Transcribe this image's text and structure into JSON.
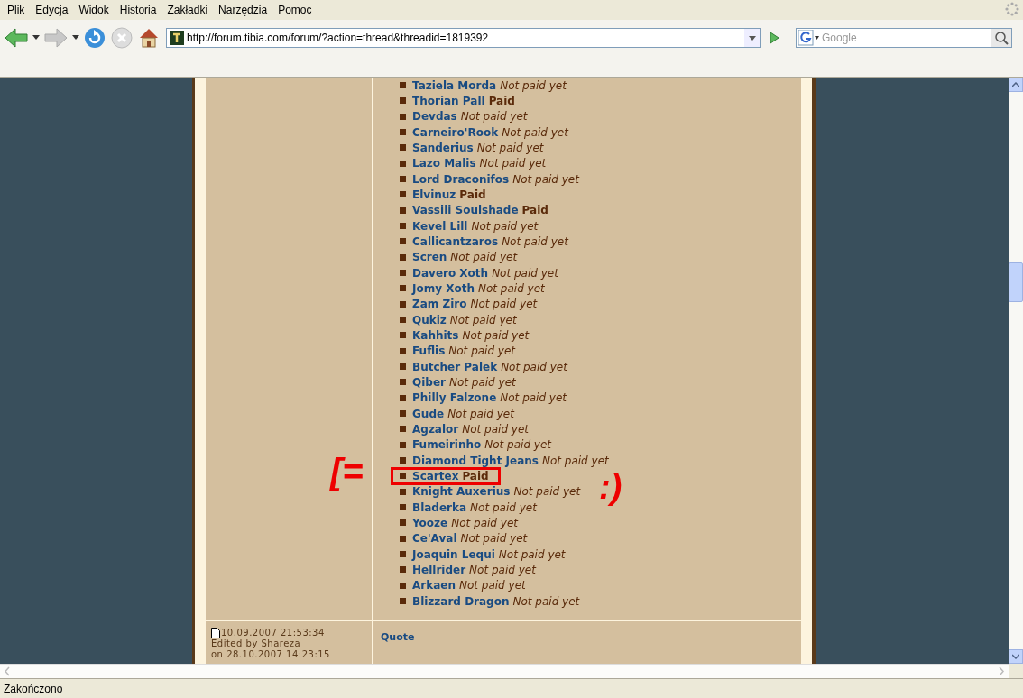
{
  "menu": [
    "Plik",
    "Edycja",
    "Widok",
    "Historia",
    "Zakładki",
    "Narzędzia",
    "Pomoc"
  ],
  "address": {
    "value": "http://forum.tibia.com/forum/?action=thread&threadid=1819392"
  },
  "search": {
    "placeholder": "Google"
  },
  "entries": [
    {
      "name": "Taziela Morda",
      "status": "Not paid yet",
      "paid": false
    },
    {
      "name": "Thorian Pall",
      "status": "Paid",
      "paid": true
    },
    {
      "name": "Devdas",
      "status": "Not paid yet",
      "paid": false
    },
    {
      "name": "Carneiro'Rook",
      "status": "Not paid yet",
      "paid": false
    },
    {
      "name": "Sanderius",
      "status": "Not paid yet",
      "paid": false
    },
    {
      "name": "Lazo Malis",
      "status": "Not paid yet",
      "paid": false
    },
    {
      "name": "Lord Draconifos",
      "status": "Not paid yet",
      "paid": false
    },
    {
      "name": "Elvinuz",
      "status": "Paid",
      "paid": true
    },
    {
      "name": "Vassili Soulshade",
      "status": "Paid",
      "paid": true
    },
    {
      "name": "Kevel Lill",
      "status": "Not paid yet",
      "paid": false
    },
    {
      "name": "Callicantzaros",
      "status": "Not paid yet",
      "paid": false
    },
    {
      "name": "Scren",
      "status": "Not paid yet",
      "paid": false
    },
    {
      "name": "Davero Xoth",
      "status": "Not paid yet",
      "paid": false
    },
    {
      "name": "Jomy Xoth",
      "status": "Not paid yet",
      "paid": false
    },
    {
      "name": "Zam Ziro",
      "status": "Not paid yet",
      "paid": false
    },
    {
      "name": "Qukiz",
      "status": "Not paid yet",
      "paid": false
    },
    {
      "name": "Kahhits",
      "status": "Not paid yet",
      "paid": false
    },
    {
      "name": "Fuflis",
      "status": "Not paid yet",
      "paid": false
    },
    {
      "name": "Butcher Palek",
      "status": "Not paid yet",
      "paid": false
    },
    {
      "name": "Qiber",
      "status": "Not paid yet",
      "paid": false
    },
    {
      "name": "Philly Falzone",
      "status": "Not paid yet",
      "paid": false
    },
    {
      "name": "Gude",
      "status": "Not paid yet",
      "paid": false
    },
    {
      "name": "Agzalor",
      "status": "Not paid yet",
      "paid": false
    },
    {
      "name": "Fumeirinho",
      "status": "Not paid yet",
      "paid": false
    },
    {
      "name": "Diamond Tight Jeans",
      "status": "Not paid yet",
      "paid": false
    },
    {
      "name": "Scartex",
      "status": "Paid",
      "paid": true,
      "highlighted": true
    },
    {
      "name": "Knight Auxerius",
      "status": "Not paid yet",
      "paid": false
    },
    {
      "name": "Bladerka",
      "status": "Not paid yet",
      "paid": false
    },
    {
      "name": "Yooze",
      "status": "Not paid yet",
      "paid": false
    },
    {
      "name": "Ce'Aval",
      "status": "Not paid yet",
      "paid": false
    },
    {
      "name": "Joaquin Lequi",
      "status": "Not paid yet",
      "paid": false
    },
    {
      "name": "Hellrider",
      "status": "Not paid yet",
      "paid": false
    },
    {
      "name": "Arkaen",
      "status": "Not paid yet",
      "paid": false
    },
    {
      "name": "Blizzard Dragon",
      "status": "Not paid yet",
      "paid": false
    }
  ],
  "annotations": {
    "left": "[=",
    "right": ":)"
  },
  "post_footer": {
    "date": "10.09.2007 21:53:34",
    "edited": "Edited by Shareza",
    "edited_on": "on 28.10.2007 14:23:15",
    "quote": "Quote"
  },
  "status_bar": "Zakończono"
}
